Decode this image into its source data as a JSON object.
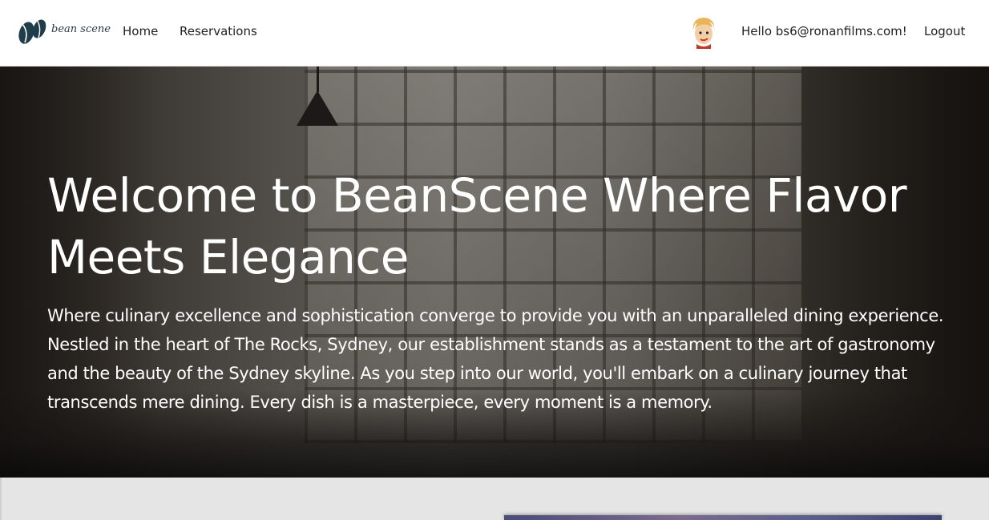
{
  "navbar": {
    "brand": {
      "logo_icon": "coffee-beans-icon",
      "text": "bean scene"
    },
    "links": {
      "home": "Home",
      "reservations": "Reservations"
    },
    "user": {
      "avatar_icon": "user-avatar",
      "greeting": "Hello bs6@ronanfilms.com!",
      "logout": "Logout"
    }
  },
  "hero": {
    "title": "Welcome to BeanScene Where Flavor Meets Elegance",
    "text": "Where culinary excellence and sophistication converge to provide you with an unparalleled dining experience. Nestled in the heart of The Rocks, Sydney, our establishment stands as a testament to the art of gastronomy and the beauty of the Sydney skyline. As you step into our world, you'll embark on a culinary journey that transcends mere dining. Every dish is a masterpiece, every moment is a memory."
  },
  "colors": {
    "brand_dark": "#1f3d4a",
    "nav_text": "#1f1f1f",
    "hero_text": "#ffffff",
    "section_bg": "#e5e5e5"
  }
}
